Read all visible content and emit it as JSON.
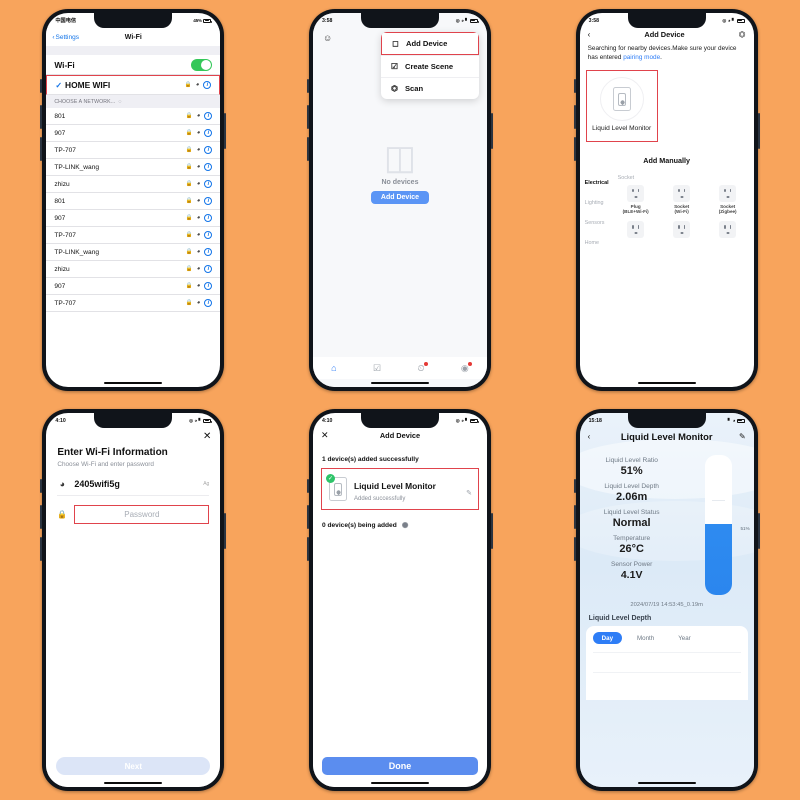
{
  "background_color": "#F8A45C",
  "accent_blue": "#2E7DF6",
  "highlight_red": "#E0434C",
  "phone1": {
    "name": "wifi-settings",
    "status": {
      "carrier": "中国电信",
      "time": "",
      "battery": "45%"
    },
    "nav": {
      "back": "Settings",
      "title": "Wi-Fi"
    },
    "wifi_toggle": {
      "label": "Wi-Fi",
      "state": "on"
    },
    "connected": {
      "ssid": "HOME WIFI",
      "checked": true
    },
    "section_header": "CHOOSE A NETWORK...",
    "networks": [
      {
        "ssid": "801"
      },
      {
        "ssid": "907"
      },
      {
        "ssid": "TP-707"
      },
      {
        "ssid": "TP-LINK_wang"
      },
      {
        "ssid": "zhizu"
      },
      {
        "ssid": "801"
      },
      {
        "ssid": "907"
      },
      {
        "ssid": "TP-707"
      },
      {
        "ssid": "TP-LINK_wang"
      },
      {
        "ssid": "zhizu"
      },
      {
        "ssid": "907"
      },
      {
        "ssid": "TP-707"
      }
    ]
  },
  "phone2": {
    "name": "home-no-devices",
    "status": {
      "time": "3:58",
      "battery": ""
    },
    "menu": [
      {
        "label": "Add Device",
        "icon": "add-device-icon",
        "highlighted": true
      },
      {
        "label": "Create Scene",
        "icon": "create-scene-icon",
        "highlighted": false
      },
      {
        "label": "Scan",
        "icon": "scan-icon",
        "highlighted": false
      }
    ],
    "empty_text": "No devices",
    "add_button": "Add Device",
    "tabs": [
      {
        "name": "home",
        "active": true,
        "badge": false
      },
      {
        "name": "scene",
        "active": false,
        "badge": false
      },
      {
        "name": "smart",
        "active": false,
        "badge": true
      },
      {
        "name": "me",
        "active": false,
        "badge": true
      }
    ]
  },
  "phone3": {
    "name": "add-device-search",
    "status": {
      "time": "3:58"
    },
    "nav": {
      "title": "Add Device"
    },
    "hint_prefix": "Searching for nearby devices.Make sure your device has entered ",
    "hint_link": "pairing mode",
    "hint_suffix": ".",
    "found_device": "Liquid Level Monitor",
    "manual_title": "Add Manually",
    "categories": [
      {
        "label": "Electrical",
        "active": true
      },
      {
        "label": "Lighting",
        "active": false
      },
      {
        "label": "Sensors",
        "active": false
      },
      {
        "label": "Home",
        "active": false
      }
    ],
    "grid_header": "Socket",
    "items": [
      {
        "name": "Plug",
        "sub": "(BLE+Wi-Fi)"
      },
      {
        "name": "Socket",
        "sub": "(Wi-Fi)"
      },
      {
        "name": "Socket",
        "sub": "(Zigbee)"
      },
      {
        "name": "",
        "sub": ""
      },
      {
        "name": "",
        "sub": ""
      },
      {
        "name": "",
        "sub": ""
      }
    ]
  },
  "phone4": {
    "name": "enter-wifi-info",
    "status": {
      "time": "4:10"
    },
    "title": "Enter Wi-Fi Information",
    "subtitle": "Choose Wi-Fi and enter password",
    "ssid_value": "2405wifi5g",
    "ssid_trailing": "Ag",
    "password_placeholder": "Password",
    "next_button": "Next"
  },
  "phone5": {
    "name": "device-added",
    "status": {
      "time": "4:10"
    },
    "nav": {
      "title": "Add Device"
    },
    "success_count_text": "1 device(s) added successfully",
    "device": {
      "name": "Liquid Level Monitor",
      "status": "Added successfully"
    },
    "pending_text": "0 device(s) being added",
    "done_button": "Done"
  },
  "phone6": {
    "name": "liquid-level-dashboard",
    "status": {
      "time": "15:18"
    },
    "nav": {
      "title": "Liquid Level Monitor"
    },
    "stats": [
      {
        "label": "Liquid Level Ratio",
        "value": "51%"
      },
      {
        "label": "Liquid Level Depth",
        "value": "2.06m"
      },
      {
        "label": "Liquid Level Status",
        "value": "Normal"
      },
      {
        "label": "Temperature",
        "value": "26°C"
      },
      {
        "label": "Sensor Power",
        "value": "4.1V"
      }
    ],
    "gauge": {
      "percent_label": "51%",
      "fill_percent": 51
    },
    "timestamp": "2024/07/19 14:53:45_0.19m",
    "chart_section_title": "Liquid Level Depth",
    "range_tabs": [
      {
        "label": "Day",
        "active": true
      },
      {
        "label": "Month",
        "active": false
      },
      {
        "label": "Year",
        "active": false
      }
    ]
  }
}
